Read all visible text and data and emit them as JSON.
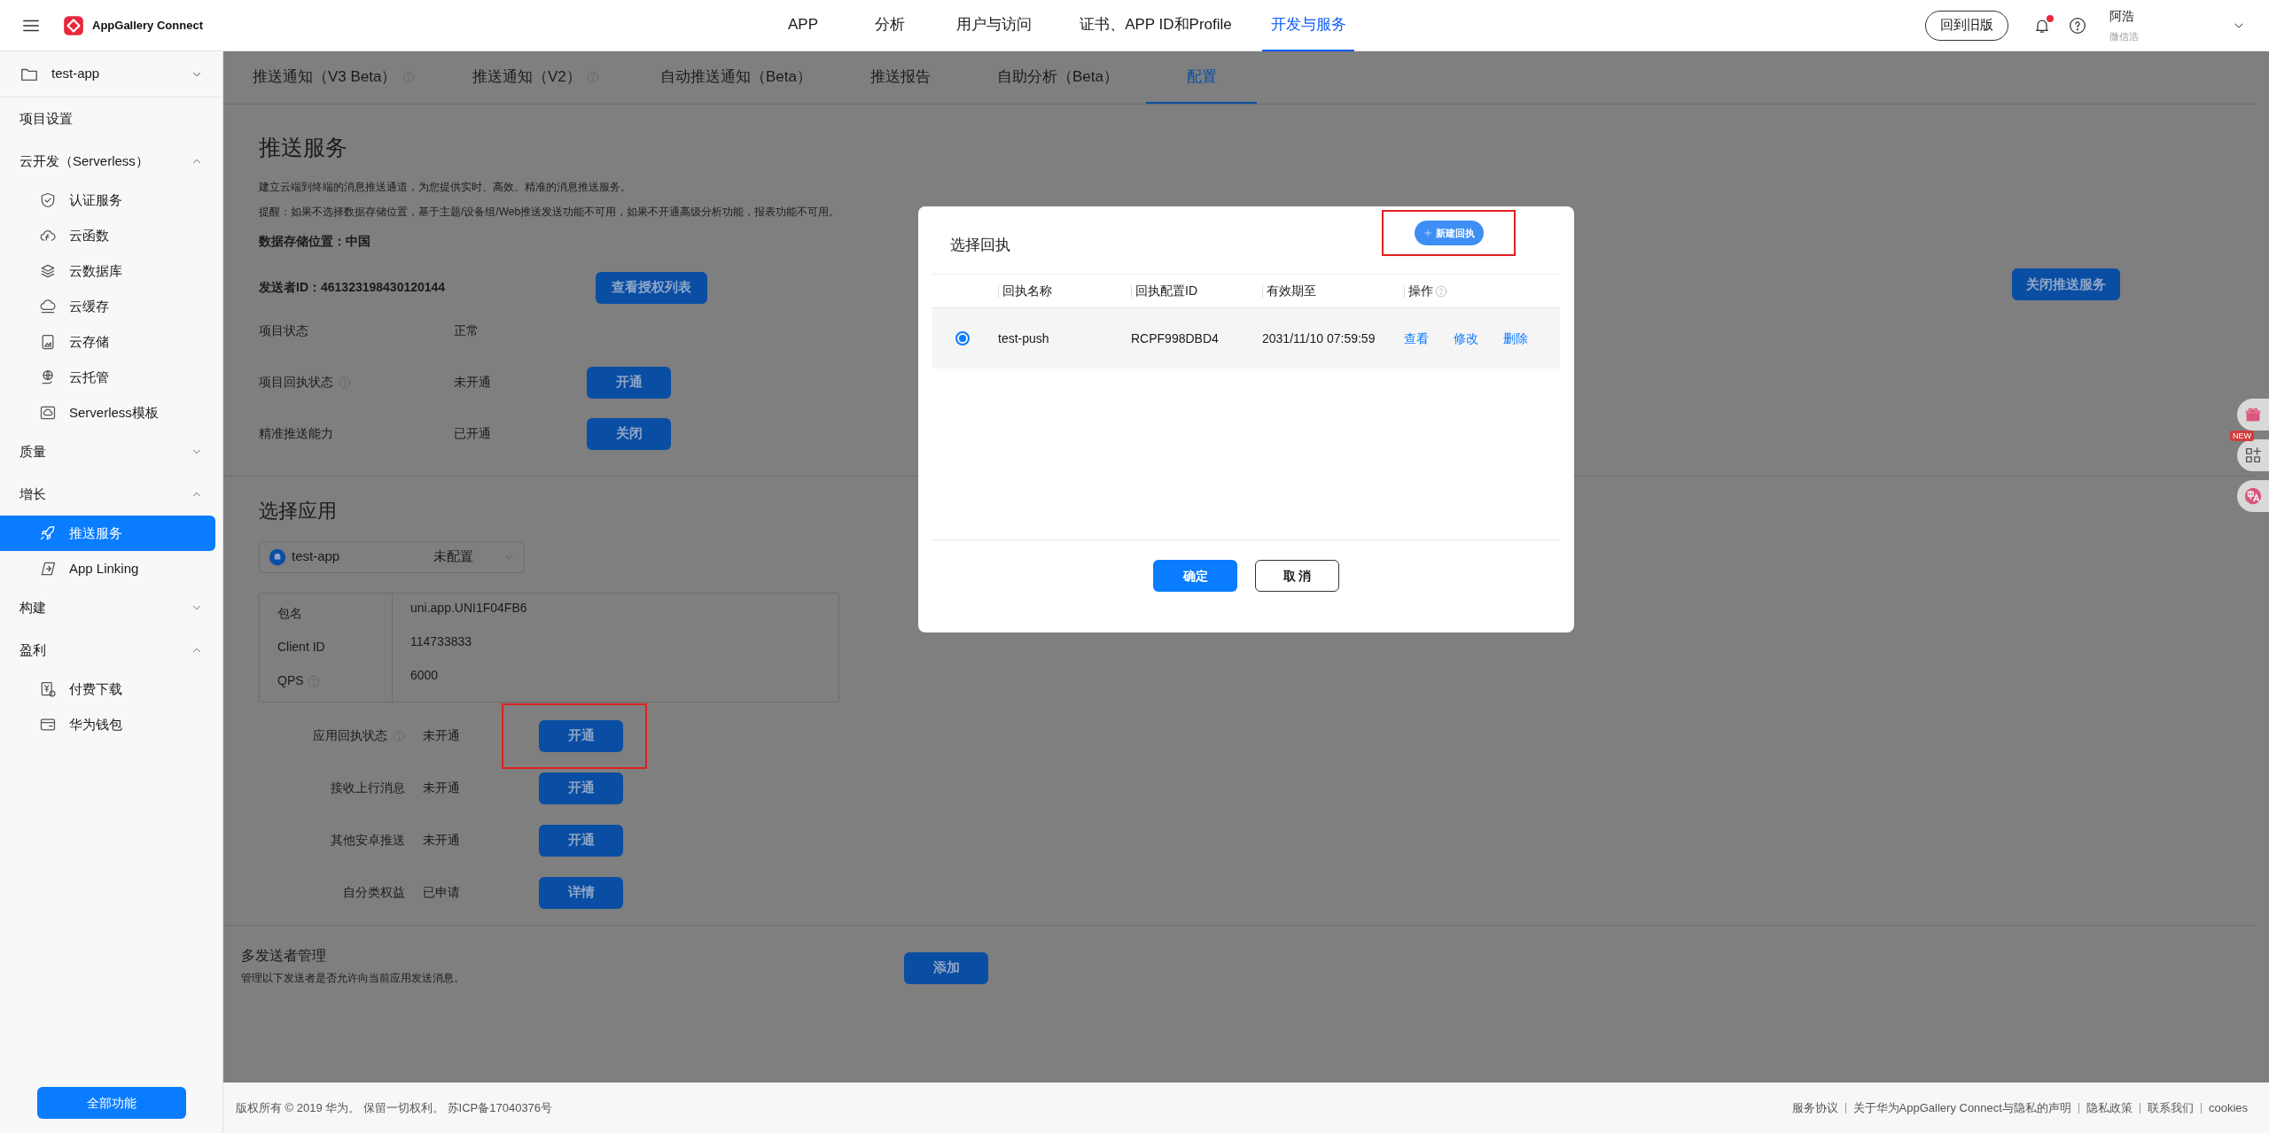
{
  "header": {
    "logo_text": "AppGallery Connect",
    "nav": [
      {
        "label": "APP",
        "selected": false
      },
      {
        "label": "分析",
        "selected": false
      },
      {
        "label": "用户与访问",
        "selected": false
      },
      {
        "label": "证书、APP ID和Profile",
        "selected": false
      },
      {
        "label": "开发与服务",
        "selected": true
      }
    ],
    "old_version_button": "回到旧版",
    "notifications": {
      "unread": true
    },
    "user": {
      "name": "阿浩",
      "subtitle": "微信浩"
    }
  },
  "sidebar": {
    "project": "test-app",
    "items": [
      {
        "kind": "link",
        "label": "项目设置"
      },
      {
        "kind": "group",
        "label": "云开发（Serverless）",
        "expanded": true,
        "children": [
          {
            "label": "认证服务",
            "selected": false
          },
          {
            "label": "云函数",
            "selected": false
          },
          {
            "label": "云数据库",
            "selected": false
          },
          {
            "label": "云缓存",
            "selected": false
          },
          {
            "label": "云存储",
            "selected": false
          },
          {
            "label": "云托管",
            "selected": false
          },
          {
            "label": "Serverless模板",
            "selected": false
          }
        ]
      },
      {
        "kind": "group",
        "label": "质量",
        "expanded": false
      },
      {
        "kind": "group",
        "label": "增长",
        "expanded": true,
        "children": [
          {
            "label": "推送服务",
            "selected": true
          },
          {
            "label": "App Linking",
            "selected": false
          }
        ]
      },
      {
        "kind": "group",
        "label": "构建",
        "expanded": false
      },
      {
        "kind": "group",
        "label": "盈利",
        "expanded": true,
        "children": [
          {
            "label": "付费下载",
            "selected": false
          },
          {
            "label": "华为钱包",
            "selected": false
          }
        ]
      }
    ],
    "all_features_button": "全部功能"
  },
  "tabs": [
    {
      "label": "推送通知（V3 Beta）",
      "help": true,
      "selected": false
    },
    {
      "label": "推送通知（V2）",
      "help": true,
      "selected": false
    },
    {
      "label": "自动推送通知（Beta）",
      "help": false,
      "selected": false
    },
    {
      "label": "推送报告",
      "help": false,
      "selected": false
    },
    {
      "label": "自助分析（Beta）",
      "help": false,
      "selected": false
    },
    {
      "label": "配置",
      "help": false,
      "selected": true
    }
  ],
  "push_service": {
    "title": "推送服务",
    "description": "建立云端到终端的消息推送通道，为您提供实时、高效、精准的消息推送服务。",
    "notice": "提醒：如果不选择数据存储位置，基于主题/设备组/Web推送发送功能不可用，如果不开通高级分析功能，报表功能不可用。",
    "storage_location": "数据存储位置：中国",
    "sender_id": "发送者ID：461323198430120144",
    "authorize_button": "查看授权列表",
    "close_button": "关闭推送服务",
    "rows": [
      {
        "label": "项目状态",
        "help": false,
        "value": "正常"
      },
      {
        "label": "项目回执状态",
        "help": true,
        "value": "未开通",
        "button": "开通"
      },
      {
        "label": "精准推送能力",
        "help": false,
        "value": "已开通",
        "button": "关闭"
      }
    ]
  },
  "select_app": {
    "title": "选择应用",
    "dropdown": {
      "app": "test-app",
      "status": "未配置"
    },
    "info": [
      {
        "label": "包名",
        "help": false,
        "value": "uni.app.UNI1F04FB6"
      },
      {
        "label": "Client ID",
        "help": false,
        "value": "114733833"
      },
      {
        "label": "QPS",
        "help": true,
        "value": "6000"
      }
    ],
    "rows": [
      {
        "label": "应用回执状态",
        "help": true,
        "value": "未开通",
        "button": "开通",
        "highlighted": true
      },
      {
        "label": "接收上行消息",
        "help": false,
        "value": "未开通",
        "button": "开通",
        "highlighted": false
      },
      {
        "label": "其他安卓推送",
        "help": false,
        "value": "未开通",
        "button": "开通",
        "highlighted": false
      },
      {
        "label": "自分类权益",
        "help": false,
        "value": "已申请",
        "button": "详情",
        "highlighted": false
      }
    ]
  },
  "multi_sender": {
    "title": "多发送者管理",
    "description": "管理以下发送者是否允许向当前应用发送消息。",
    "add_button": "添加"
  },
  "floating_tools": [
    {
      "kind": "gift"
    },
    {
      "kind": "apps",
      "badge": "NEW"
    },
    {
      "kind": "translate"
    }
  ],
  "modal": {
    "title": "选择回执",
    "new_button": {
      "label": "新建回执",
      "highlighted": true
    },
    "columns": [
      {
        "label": "回执名称",
        "help": false
      },
      {
        "label": "回执配置ID",
        "help": false
      },
      {
        "label": "有效期至",
        "help": false
      },
      {
        "label": "操作",
        "help": true
      }
    ],
    "rows": [
      {
        "selected": true,
        "name": "test-push",
        "config_id": "RCPF998DBD4",
        "expiry": "2031/11/10 07:59:59",
        "actions": [
          "查看",
          "修改",
          "删除"
        ]
      }
    ],
    "confirm_button": "确定",
    "cancel_button": "取 消"
  },
  "footer": {
    "copyright": "版权所有 © 2019 华为。 保留一切权利。 苏ICP备17040376号",
    "links": [
      "服务协议",
      "关于华为AppGallery Connect与隐私的声明",
      "隐私政策",
      "联系我们",
      "cookies"
    ]
  }
}
